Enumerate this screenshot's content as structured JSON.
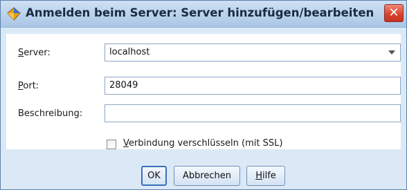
{
  "window": {
    "title": "Anmelden beim Server: Server hinzufügen/bearbeiten",
    "close_glyph": "✕"
  },
  "form": {
    "server": {
      "label_mnemonic": "S",
      "label_rest": "erver:",
      "value": "localhost"
    },
    "port": {
      "label_mnemonic": "P",
      "label_rest": "ort:",
      "value": "28049"
    },
    "description": {
      "label": "Beschreibung:",
      "value": ""
    },
    "ssl": {
      "label_mnemonic": "V",
      "label_rest": "erbindung verschlüsseln (mit SSL)",
      "checked": false
    }
  },
  "buttons": {
    "ok": "OK",
    "cancel": "Abbrechen",
    "help_mnemonic": "H",
    "help_rest": "ilfe"
  },
  "colors": {
    "window_bg": "#dbe9f7",
    "close_red": "#d9442c",
    "field_border": "#8ea6c4"
  }
}
